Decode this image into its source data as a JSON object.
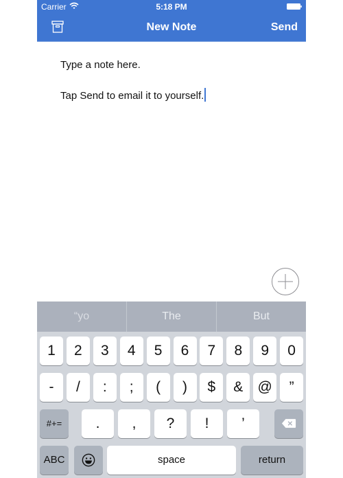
{
  "status_bar": {
    "carrier": "Carrier",
    "time": "5:18 PM",
    "wifi_icon": "wifi-icon",
    "battery_icon": "battery-icon"
  },
  "nav_bar": {
    "title": "New Note",
    "send_label": "Send",
    "left_icon": "archive-box-icon",
    "background_color": "#3F76D2"
  },
  "editor": {
    "lines": [
      "Type a note here.",
      "Tap Send to email it to yourself."
    ]
  },
  "add_button": {
    "icon": "plus-circle-icon"
  },
  "suggestions": [
    "“yo",
    "The",
    "But"
  ],
  "keyboard": {
    "row1": [
      "1",
      "2",
      "3",
      "4",
      "5",
      "6",
      "7",
      "8",
      "9",
      "0"
    ],
    "row2": [
      "-",
      "/",
      ":",
      ";",
      "(",
      ")",
      "$",
      "&",
      "@",
      "”"
    ],
    "row3_left": "#+=",
    "row3": [
      ".",
      ",",
      "?",
      "!",
      "’"
    ],
    "row3_right_icon": "backspace-icon",
    "row4_abc": "ABC",
    "row4_emoji_icon": "emoji-icon",
    "row4_space": "space",
    "row4_return": "return"
  }
}
